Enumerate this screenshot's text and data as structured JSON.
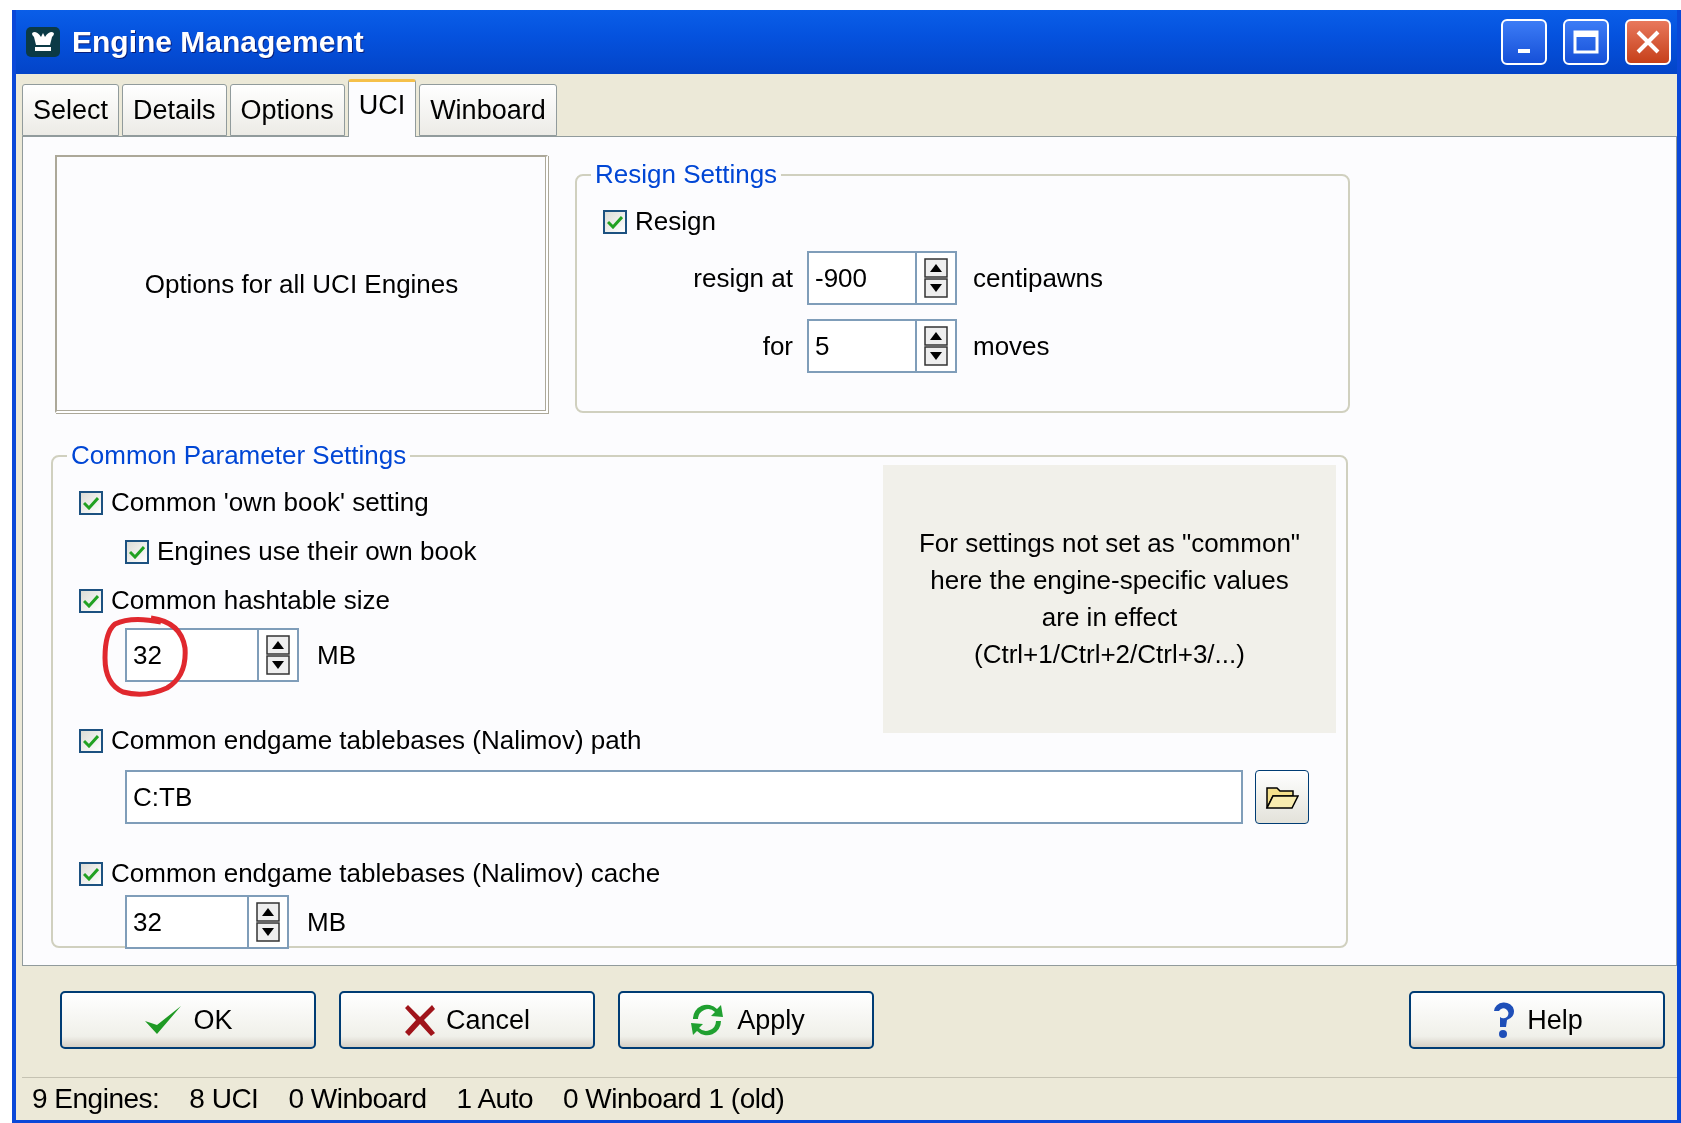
{
  "window": {
    "title": "Engine Management"
  },
  "tabs": [
    {
      "label": "Select",
      "selected": false
    },
    {
      "label": "Details",
      "selected": false
    },
    {
      "label": "Options",
      "selected": false
    },
    {
      "label": "UCI",
      "selected": true
    },
    {
      "label": "Winboard",
      "selected": false
    }
  ],
  "info_box": {
    "text": "Options for all UCI Engines"
  },
  "resign_settings": {
    "title": "Resign Settings",
    "resign": {
      "label": "Resign",
      "checked": true
    },
    "rows": [
      {
        "label": "resign at",
        "value": "-900",
        "unit": "centipawns"
      },
      {
        "label": "for",
        "value": "5",
        "unit": "moves"
      }
    ]
  },
  "common_parameters": {
    "title": "Common Parameter Settings",
    "own_book": {
      "label": "Common 'own book' setting",
      "checked": true
    },
    "engines_own_book": {
      "label": "Engines use their own book",
      "checked": true
    },
    "hashtable": {
      "label": "Common hashtable size",
      "checked": true,
      "value": "32",
      "unit": "MB"
    },
    "note": [
      "For settings not set as \"common\"",
      "here the engine-specific values",
      "are in effect",
      "(Ctrl+1/Ctrl+2/Ctrl+3/...)"
    ],
    "tablebase_path": {
      "label": "Common endgame tablebases (Nalimov) path",
      "checked": true,
      "value": "C:TB"
    },
    "tablebase_cache": {
      "label": "Common endgame tablebases (Nalimov) cache",
      "checked": true,
      "value": "32",
      "unit": "MB"
    }
  },
  "buttons": [
    {
      "label": "OK",
      "kind": "ok"
    },
    {
      "label": "Cancel",
      "kind": "cancel"
    },
    {
      "label": "Apply",
      "kind": "apply"
    },
    {
      "label": "Help",
      "kind": "help"
    }
  ],
  "status_bar": [
    "9 Engines:",
    "8 UCI",
    "0 Winboard",
    "1 Auto",
    "0 Winboard 1 (old)"
  ]
}
